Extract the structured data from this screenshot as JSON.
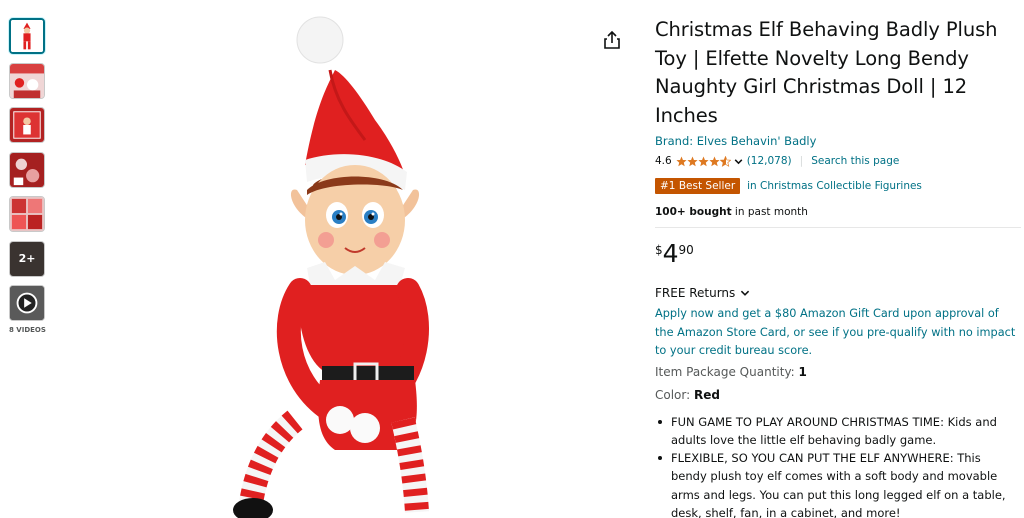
{
  "thumbnails": {
    "more_label": "2+",
    "videos_label": "8 VIDEOS"
  },
  "product": {
    "title": "Christmas Elf Behaving Badly Plush Toy | Elfette Novelty Long Bendy Naughty Girl Christmas Doll | 12 Inches",
    "brand": "Brand: Elves Behavin' Badly",
    "rating": "4.6",
    "rating_value": 4.6,
    "review_count": "(12,078)",
    "search_page": "Search this page",
    "badge": "#1 Best Seller",
    "badge_category": "in Christmas Collectible Figurines",
    "bought_bold": "100+ bought",
    "bought_rest": " in past month",
    "price_symbol": "$",
    "price_whole": "4",
    "price_fraction": "90",
    "returns": "FREE Returns",
    "promo": "Apply now and get a $80 Amazon Gift Card upon approval of the Amazon Store Card, or see if you pre-qualify with no impact to your credit bureau score.",
    "qty_label": "Item Package Quantity: ",
    "qty_value": "1",
    "color_label": "Color: ",
    "color_value": "Red",
    "bullets": [
      "FUN GAME TO PLAY AROUND CHRISTMAS TIME: Kids and adults love the little elf behaving badly game.",
      "FLEXIBLE, SO YOU CAN PUT THE ELF ANYWHERE: This bendy plush toy elf comes with a soft body and movable arms and legs. You can put this long legged elf on a table, desk, shelf, fan, in a cabinet, and more!"
    ]
  },
  "colors": {
    "link": "#007185",
    "badge": "#c45500",
    "star": "#de7921",
    "elf_red": "#e02020"
  },
  "icons": {
    "share": "share-icon",
    "star": "star-icon",
    "chevron": "chevron-down-icon",
    "play": "play-icon"
  }
}
